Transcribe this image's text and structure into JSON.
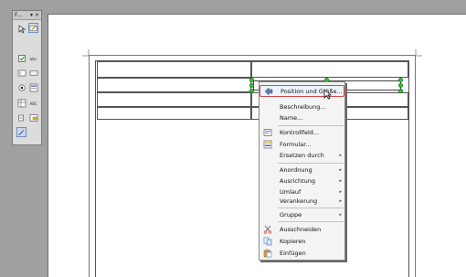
{
  "toolbox": {
    "title": "F...",
    "dropdown": "▾",
    "close": "×",
    "buttons": [
      {
        "icon": "select-arrow-icon"
      },
      {
        "icon": "design-mode-icon"
      },
      {
        "icon": "checkbox-icon"
      },
      {
        "icon": "label-icon"
      },
      {
        "icon": "textbox-icon"
      },
      {
        "icon": "push-button-icon"
      },
      {
        "icon": "option-button-icon"
      },
      {
        "icon": "listbox-icon"
      },
      {
        "icon": "table-control-icon"
      },
      {
        "icon": "formatted-field-icon"
      },
      {
        "icon": "form-navigator-icon"
      },
      {
        "icon": "more-controls-icon"
      },
      {
        "icon": "wizard-icon"
      }
    ]
  },
  "menu": {
    "items": [
      {
        "label": "Position und Größe...",
        "icon": "position-size-icon",
        "highlighted": true
      },
      {
        "label": "Beschreibung..."
      },
      {
        "label": "Name..."
      },
      {
        "label": "Kontrollfeld...",
        "icon": "control-properties-icon"
      },
      {
        "label": "Formular...",
        "icon": "form-properties-icon"
      },
      {
        "label": "Ersetzen durch",
        "submenu": true
      },
      {
        "label": "Anordnung",
        "submenu": true
      },
      {
        "label": "Ausrichtung",
        "submenu": true
      },
      {
        "label": "Umlauf",
        "submenu": true
      },
      {
        "label": "Verankerung",
        "submenu": true
      },
      {
        "label": "Gruppe",
        "submenu": true
      },
      {
        "label": "Ausschneiden",
        "icon": "cut-icon"
      },
      {
        "label": "Kopieren",
        "icon": "copy-icon"
      },
      {
        "label": "Einfügen",
        "icon": "paste-icon"
      }
    ],
    "submenu_arrow": "▸"
  }
}
